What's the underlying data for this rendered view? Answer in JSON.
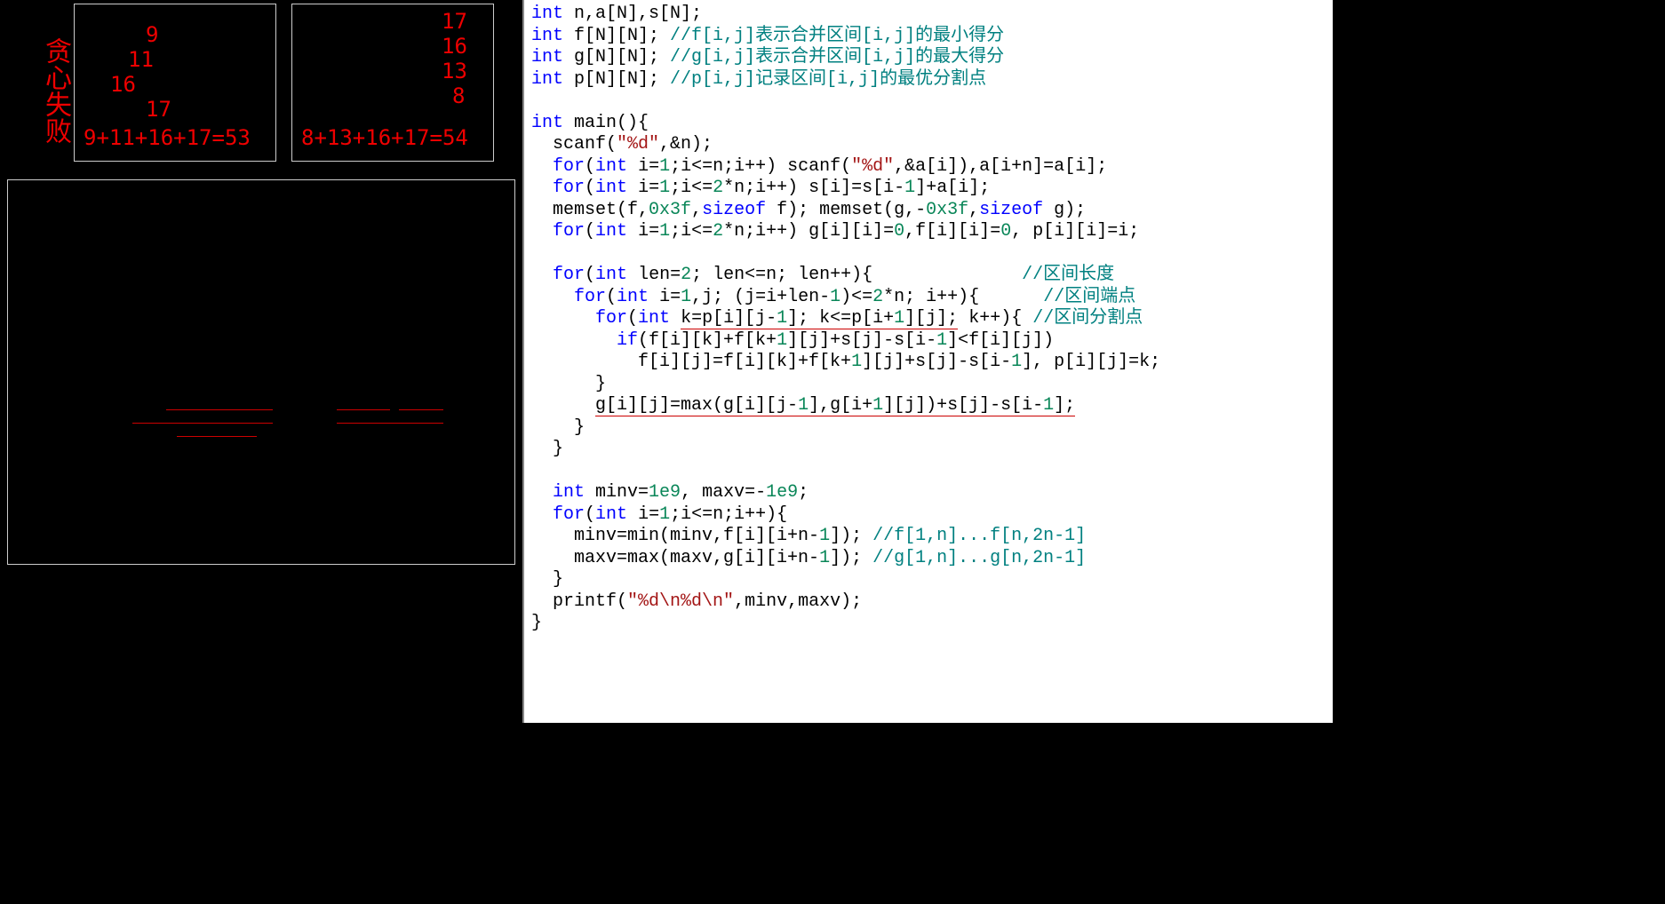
{
  "left": {
    "greedy_fail_label": "贪心失败",
    "box1": {
      "vals": [
        "9",
        "11",
        "16",
        "17"
      ],
      "sum": "9+11+16+17=53"
    },
    "box2": {
      "vals": [
        "17",
        "16",
        "13",
        "8"
      ],
      "sum": "8+13+16+17=54"
    }
  },
  "code": {
    "l1_int": "int",
    "l1_rest": " n,a[N],s[N];",
    "l2_int": "int",
    "l2_decl": " f[N][N]; ",
    "l2_cmt": "//f[i,j]表示合并区间[i,j]的最小得分",
    "l3_int": "int",
    "l3_decl": " g[N][N]; ",
    "l3_cmt": "//g[i,j]表示合并区间[i,j]的最大得分",
    "l4_int": "int",
    "l4_decl": " p[N][N]; ",
    "l4_cmt": "//p[i,j]记录区间[i,j]的最优分割点",
    "l6_int": "int",
    "l6_rest": " main(){",
    "l7a": "  scanf(",
    "l7s": "\"%d\"",
    "l7b": ",&n);",
    "l8_for": "for",
    "l8a": "(",
    "l8_int": "int",
    "l8b": " i=",
    "l8_1a": "1",
    "l8c": ";i<=n;i++) scanf(",
    "l8s": "\"%d\"",
    "l8d": ",&a[i]),a[i+n]=a[i];",
    "l9_for": "for",
    "l9a": "(",
    "l9_int": "int",
    "l9b": " i=",
    "l9_1": "1",
    "l9c": ";i<=",
    "l9_2": "2",
    "l9d": "*n;i++) s[i]=s[i-",
    "l9_1b": "1",
    "l9e": "]+a[i];",
    "l10a": "  memset(f,",
    "l10_0x3f": "0x3f",
    "l10b": ",",
    "l10_sizeof": "sizeof",
    "l10c": " f); memset(g,-",
    "l10_0x3fb": "0x3f",
    "l10d": ",",
    "l10_sizeofb": "sizeof",
    "l10e": " g);",
    "l11_for": "for",
    "l11a": "(",
    "l11_int": "int",
    "l11b": " i=",
    "l11_1": "1",
    "l11c": ";i<=",
    "l11_2": "2",
    "l11d": "*n;i++) g[i][i]=",
    "l11_0a": "0",
    "l11e": ",f[i][i]=",
    "l11_0b": "0",
    "l11f": ", p[i][i]=i;",
    "l13_for": "for",
    "l13a": "(",
    "l13_int": "int",
    "l13b": " len=",
    "l13_2": "2",
    "l13c": "; len<=n; len++){",
    "l13_cmt": "//区间长度",
    "l14_for": "for",
    "l14a": "(",
    "l14_int": "int",
    "l14b": " i=",
    "l14_1": "1",
    "l14c": ",j; (j=i+len-",
    "l14_1b": "1",
    "l14d": ")<=",
    "l14_2": "2",
    "l14e": "*n; i++){",
    "l14_cmt": "//区间端点",
    "l15_for": "for",
    "l15a": "(",
    "l15_int": "int",
    "l15b": " ",
    "l15_ul": "k=p[i][j-1]; k<=p[i+1][j];",
    "l15c": " k++){ ",
    "l15_cmt": "//区间分割点",
    "l15_ul_pre": "k=p[i][j-",
    "l15_ul_1a": "1",
    "l15_ul_mid": "]; k<=p[i+",
    "l15_ul_1b": "1",
    "l15_ul_suf": "][j];",
    "l16_if": "if",
    "l16a": "(f[i][k]+f[k+",
    "l16_1a": "1",
    "l16b": "][j]+s[j]-s[i-",
    "l16_1b": "1",
    "l16c": "]<f[i][j])",
    "l17a": "          f[i][j]=f[i][k]+f[k+",
    "l17_1a": "1",
    "l17b": "][j]+s[j]-s[i-",
    "l17_1b": "1",
    "l17c": "], p[i][j]=k;",
    "l18": "      }",
    "l19a": "      ",
    "l19_ul_pre": "g[i][j]=max(g[i][j-",
    "l19_ul_1a": "1",
    "l19_ul_mid": "],g[i+",
    "l19_ul_1b": "1",
    "l19_ul_mid2": "][j])+s[j]-s[i-",
    "l19_ul_1c": "1",
    "l19_ul_suf": "];",
    "l20": "    }",
    "l21": "  }",
    "l23_int": "int",
    "l23a": " minv=",
    "l23_1e9a": "1e9",
    "l23b": ", maxv=-",
    "l23_1e9b": "1e9",
    "l23c": ";",
    "l24_for": "for",
    "l24a": "(",
    "l24_int": "int",
    "l24b": " i=",
    "l24_1": "1",
    "l24c": ";i<=n;i++){",
    "l25a": "    minv=min(minv,f[i][i+n-",
    "l25_1": "1",
    "l25b": "]); ",
    "l25_cmt": "//f[1,n]...f[n,2n-1]",
    "l26a": "    maxv=max(maxv,g[i][i+n-",
    "l26_1": "1",
    "l26b": "]); ",
    "l26_cmt": "//g[1,n]...g[n,2n-1]",
    "l27": "  }",
    "l28a": "  printf(",
    "l28s": "\"%d\\n%d\\n\"",
    "l28b": ",minv,maxv);",
    "l29": "}"
  }
}
